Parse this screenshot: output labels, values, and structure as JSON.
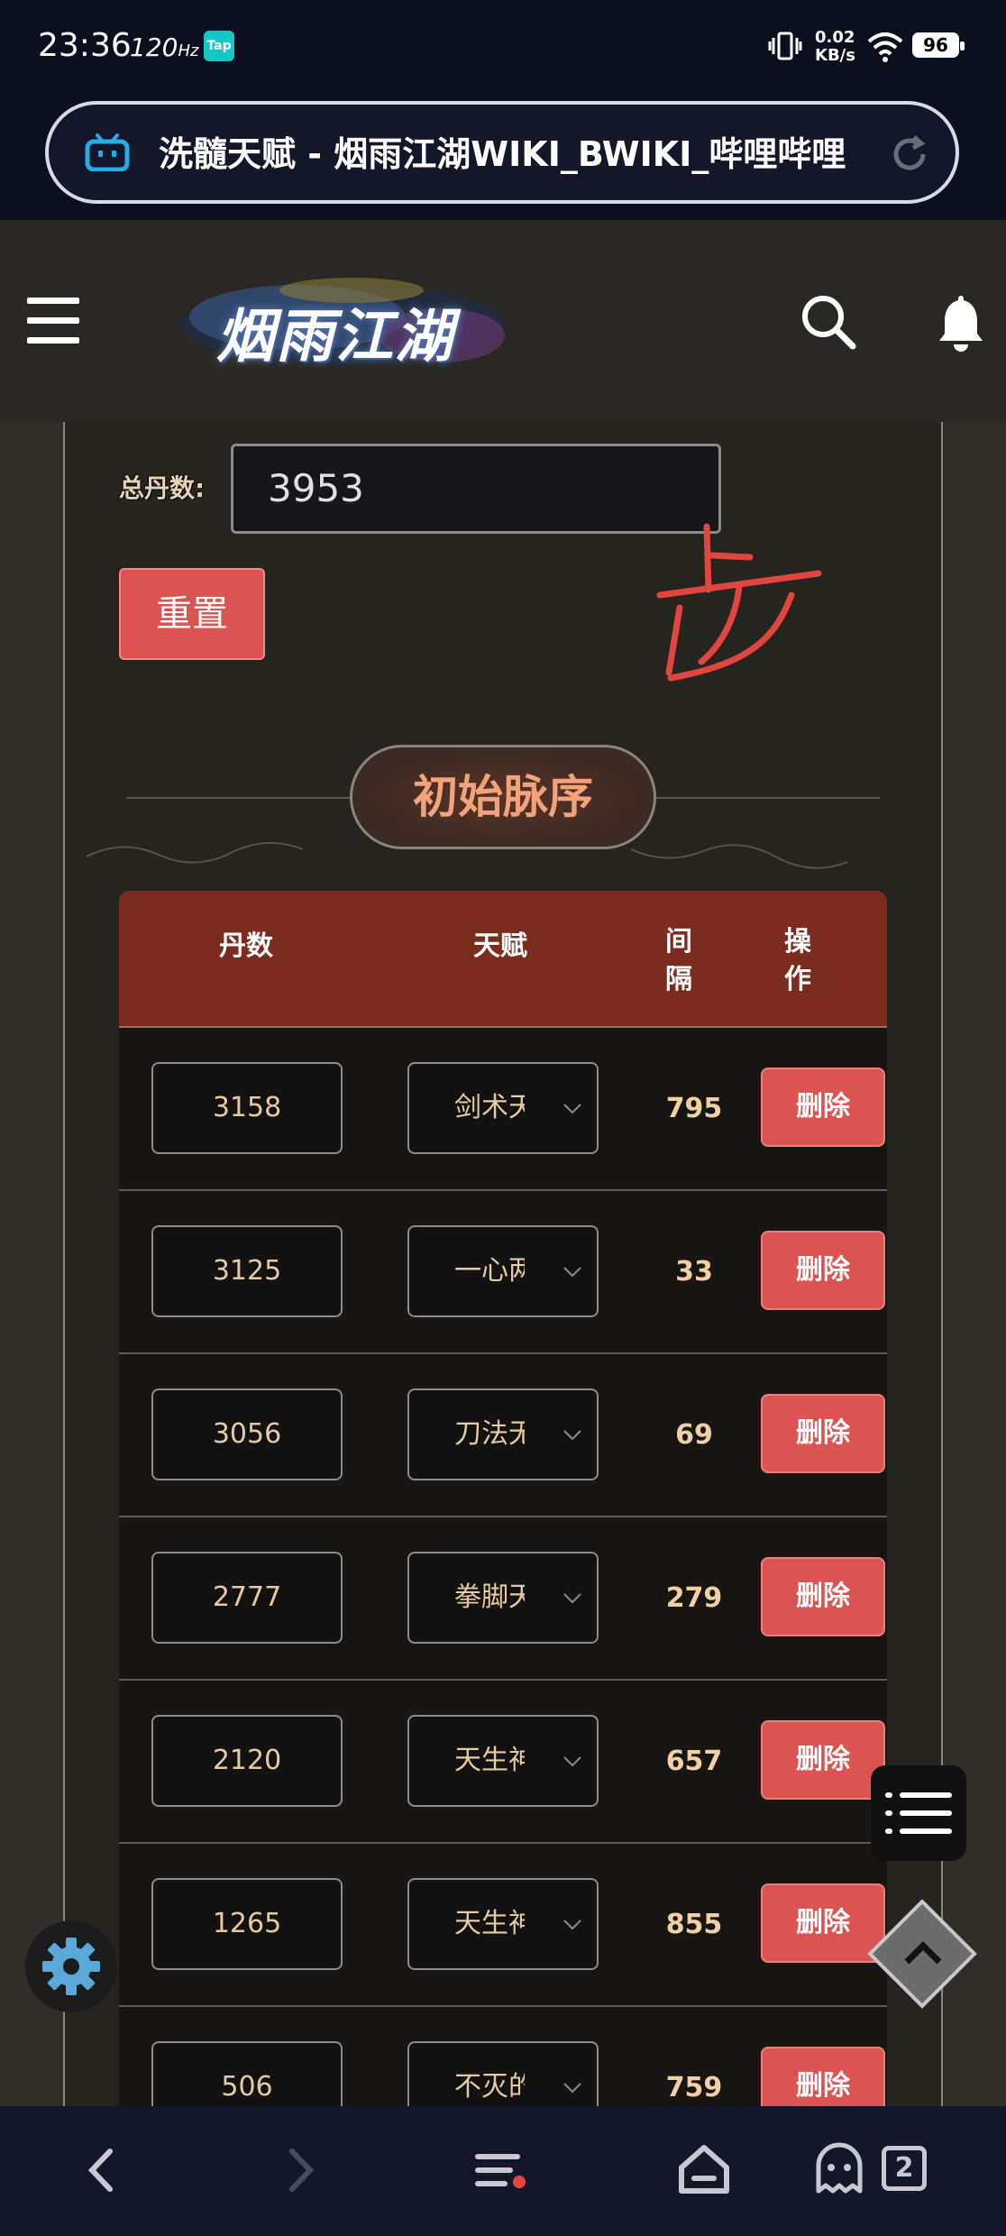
{
  "status_bar": {
    "time": "23:36",
    "refresh_rate": "120",
    "refresh_unit": "Hz",
    "app_badge": "Tap",
    "net_speed_value": "0.02",
    "net_speed_unit": "KB/s",
    "battery": "96"
  },
  "browser": {
    "page_title": "洗髓天赋 - 烟雨江湖WIKI_BWIKI_哔哩哔哩",
    "tab_count": "2"
  },
  "header": {
    "logo_text": "烟雨江湖"
  },
  "form": {
    "total_label": "总丹数:",
    "total_value": "3953",
    "reset_label": "重置",
    "handwritten_char": "步"
  },
  "section": {
    "title": "初始脉序"
  },
  "table": {
    "columns": [
      "丹数",
      "天赋",
      "间\n隔",
      "操\n作"
    ],
    "delete_label": "删除",
    "rows": [
      {
        "dan": "3158",
        "talent": "剑术天",
        "interval": "795"
      },
      {
        "dan": "3125",
        "talent": "一心两",
        "interval": "33"
      },
      {
        "dan": "3056",
        "talent": "刀法无",
        "interval": "69"
      },
      {
        "dan": "2777",
        "talent": "拳脚天",
        "interval": "279"
      },
      {
        "dan": "2120",
        "talent": "天生神",
        "interval": "657"
      },
      {
        "dan": "1265",
        "talent": "天生神",
        "interval": "855"
      },
      {
        "dan": "506",
        "talent": "不灭的",
        "interval": "759"
      }
    ]
  },
  "colors": {
    "accent_red": "#dc5451",
    "table_header": "#7c2c1e",
    "section_title": "#f2a37a",
    "bilibili_blue": "#23ade5"
  }
}
